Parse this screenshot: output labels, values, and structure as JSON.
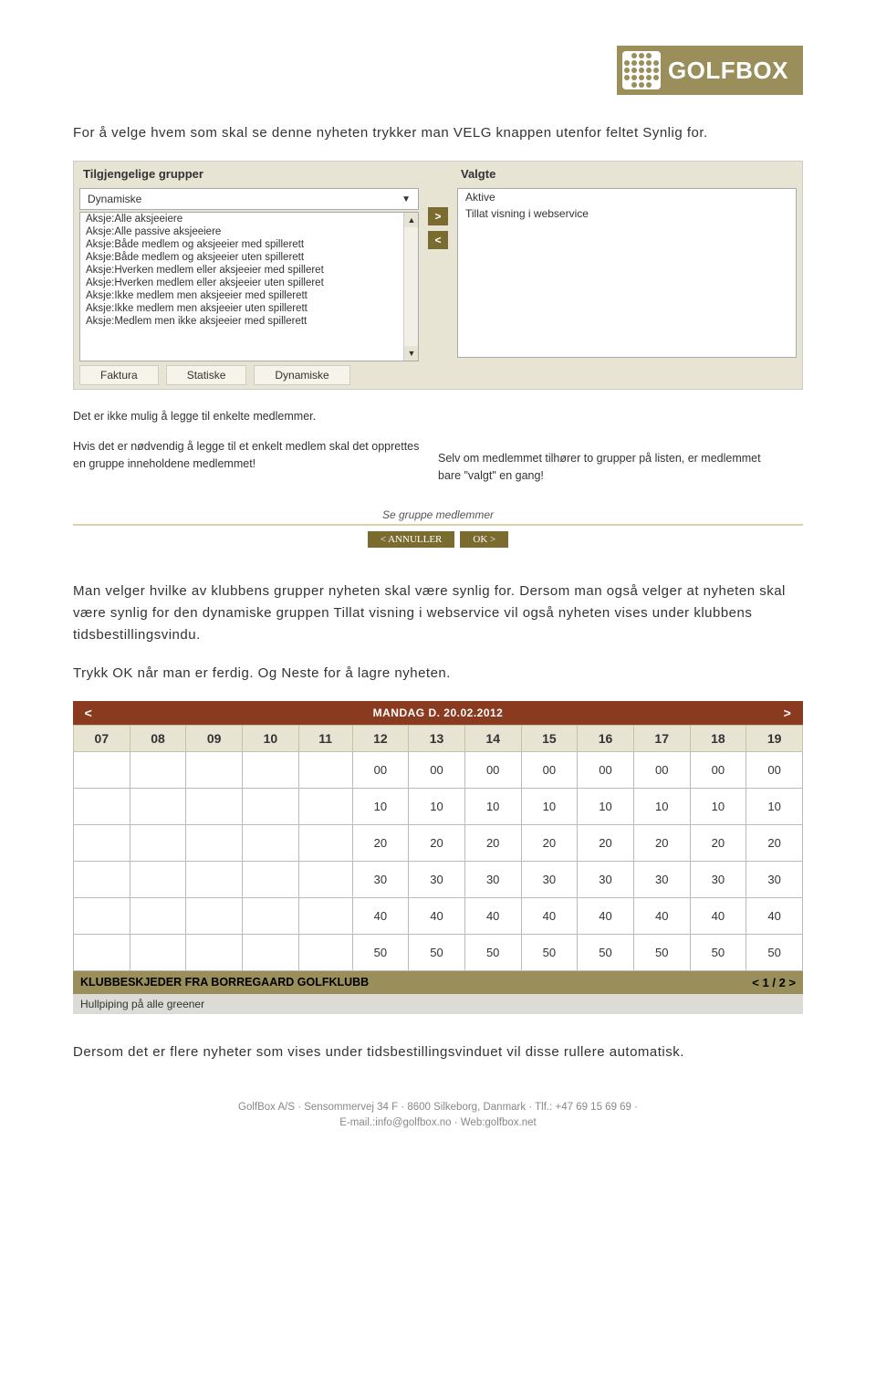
{
  "logo": {
    "text": "GOLFBOX"
  },
  "para1": "For å velge hvem som skal se denne nyheten trykker man VELG knappen utenfor feltet Synlig for.",
  "groups_panel": {
    "left_header": "Tilgjengelige grupper",
    "right_header": "Valgte",
    "dropdown_value": "Dynamiske",
    "list_items": [
      "Aksje:Alle aksjeeiere",
      "Aksje:Alle passive aksjeeiere",
      "Aksje:Både medlem og aksjeeier med spillerett",
      "Aksje:Både medlem og aksjeeier uten spillerett",
      "Aksje:Hverken medlem eller aksjeeier med spilleret",
      "Aksje:Hverken medlem eller aksjeeier uten spilleret",
      "Aksje:Ikke medlem men aksjeeier med spillerett",
      "Aksje:Ikke medlem men aksjeeier uten spillerett",
      "Aksje:Medlem men ikke aksjeeier med spillerett"
    ],
    "selected_items": [
      "Aktive",
      "Tillat visning i webservice"
    ],
    "move_right": ">",
    "move_left": "<",
    "tabs": [
      "Faktura",
      "Statiske",
      "Dynamiske"
    ]
  },
  "notes": {
    "note1": "Det er ikke mulig å legge til enkelte medlemmer.",
    "note2": "Hvis det er nødvendig å legge til et enkelt medlem skal det opprettes en gruppe inneholdene medlemmet!",
    "note3": "Selv om medlemmet tilhører to grupper på listen, er medlemmet bare \"valgt\" en gang!",
    "see_members": "Se gruppe medlemmer"
  },
  "actions": {
    "cancel": "< ANNULLER",
    "ok": "OK >"
  },
  "para2": "Man velger hvilke av klubbens grupper nyheten skal være synlig for. Dersom man også velger at nyheten skal være synlig for den dynamiske gruppen Tillat visning i webservice vil også nyheten vises under klubbens tidsbestillingsvindu.",
  "para3": "Trykk OK når man er ferdig. Og Neste for å lagre nyheten.",
  "schedule": {
    "date_label": "MANDAG D. 20.02.2012",
    "prev": "<",
    "next": ">",
    "hours": [
      "07",
      "08",
      "09",
      "10",
      "11",
      "12",
      "13",
      "14",
      "15",
      "16",
      "17",
      "18",
      "19"
    ],
    "rows": [
      [
        "",
        "",
        "",
        "",
        "",
        "00",
        "00",
        "00",
        "00",
        "00",
        "00",
        "00",
        "00"
      ],
      [
        "",
        "",
        "",
        "",
        "",
        "10",
        "10",
        "10",
        "10",
        "10",
        "10",
        "10",
        "10"
      ],
      [
        "",
        "",
        "",
        "",
        "",
        "20",
        "20",
        "20",
        "20",
        "20",
        "20",
        "20",
        "20"
      ],
      [
        "",
        "",
        "",
        "",
        "",
        "30",
        "30",
        "30",
        "30",
        "30",
        "30",
        "30",
        "30"
      ],
      [
        "",
        "",
        "",
        "",
        "",
        "40",
        "40",
        "40",
        "40",
        "40",
        "40",
        "40",
        "40"
      ],
      [
        "",
        "",
        "",
        "",
        "",
        "50",
        "50",
        "50",
        "50",
        "50",
        "50",
        "50",
        "50"
      ]
    ]
  },
  "klubb": {
    "title": "KLUBBESKJEDER FRA BORREGAARD GOLFKLUBB",
    "pager": "<  1 / 2  >",
    "message": "Hullpiping på alle greener"
  },
  "para4": "Dersom det er flere nyheter som vises under tidsbestillingsvinduet vil disse rullere automatisk.",
  "footer": {
    "line1": "GolfBox A/S · Sensommervej 34 F · 8600 Silkeborg, Danmark · Tlf.: +47 69 15 69 69 ·",
    "line2": "E-mail.:info@golfbox.no · Web:golfbox.net"
  }
}
